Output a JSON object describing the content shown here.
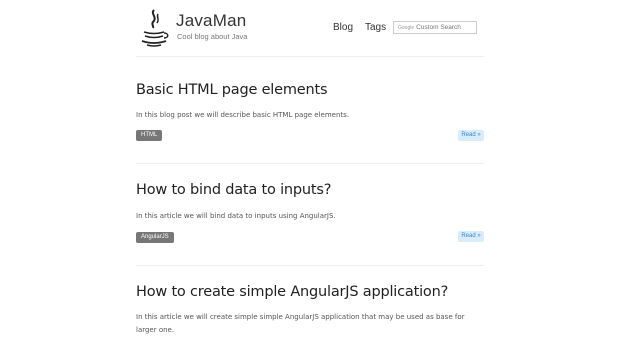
{
  "header": {
    "brand_title": "JavaMan",
    "brand_tagline": "Cool blog about Java",
    "logo_icon": "java-coffee-cup-icon",
    "nav": [
      {
        "label": "Blog"
      },
      {
        "label": "Tags"
      }
    ],
    "search": {
      "google_label": "Google",
      "placeholder": "Custom Search"
    }
  },
  "posts": [
    {
      "title": "Basic HTML page elements",
      "excerpt": "In this blog post we will describe basic HTML page elements.",
      "tag": "HTML",
      "read_label": "Read »"
    },
    {
      "title": "How to bind data to inputs?",
      "excerpt": "In this article we will bind data to inputs using AngularJS.",
      "tag": "AngularJS",
      "read_label": "Read »"
    },
    {
      "title": "How to create simple AngularJS application?",
      "excerpt": "In this article we will create simple simple AngularJS application that may be used as base for larger one."
    }
  ],
  "colors": {
    "tag_bg": "#777777",
    "read_bg": "#d9ecfb",
    "read_text": "#3a87c7"
  }
}
